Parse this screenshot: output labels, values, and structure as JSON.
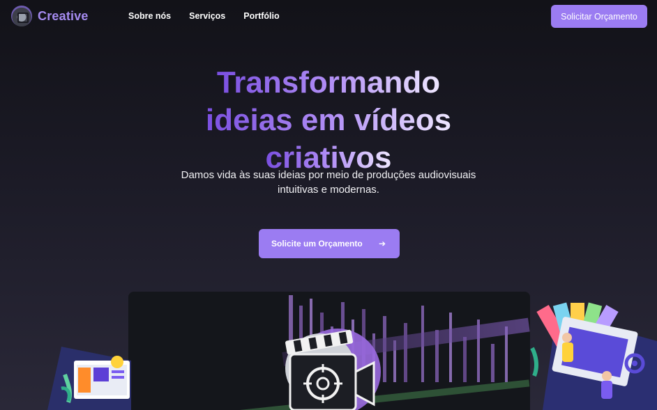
{
  "nav": {
    "brand": "Creative",
    "links": [
      "Sobre nós",
      "Serviços",
      "Portfólio"
    ],
    "cta_label": "Solicitar Orçamento"
  },
  "hero": {
    "title_lines": [
      "Transformando",
      "ideias em vídeos",
      "criativos"
    ],
    "subtitle": "Damos vida às suas ideias por meio de produções audiovisuais intuitivas e modernas.",
    "cta_label": "Solicite um Orçamento",
    "cta_icon": "arrow-right-icon"
  },
  "colors": {
    "accent": "#9b7cf2",
    "brand_text": "#a58bf0",
    "background_top": "#121218",
    "background_bottom": "#2a2838"
  },
  "images": {
    "hero_image": "video-editing-timeline-with-clapperboard",
    "left_illustration": "designer-monitor-lightbulb-illustration",
    "right_illustration": "designer-drawing-color-palette-illustration"
  }
}
